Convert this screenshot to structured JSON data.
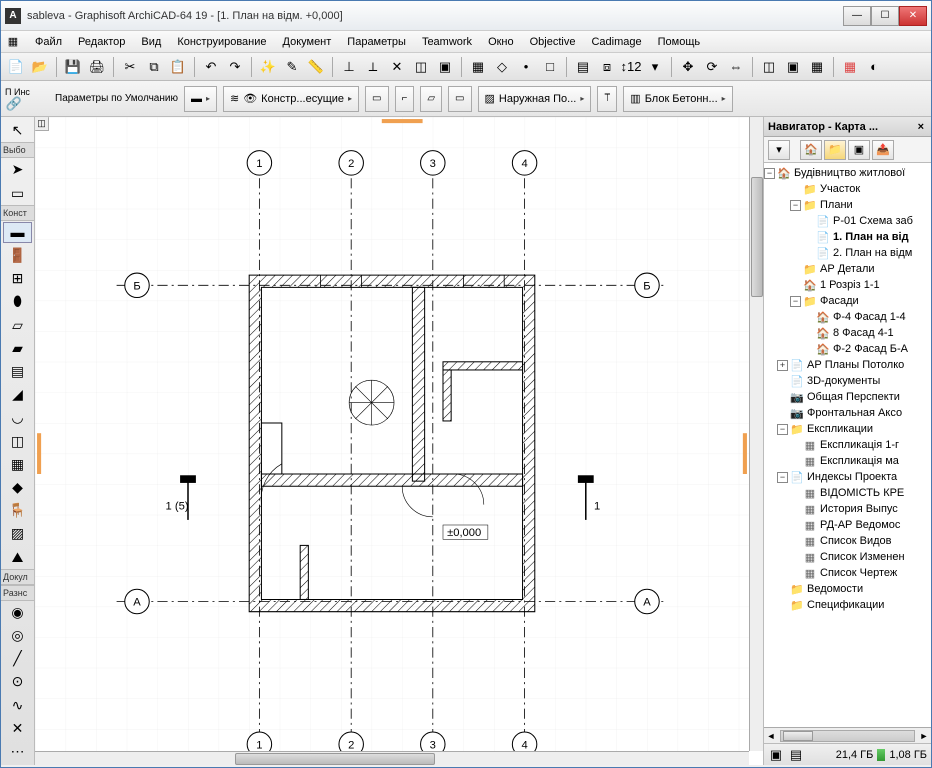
{
  "title": "sableva - Graphisoft ArchiCAD-64 19 - [1. План на відм. +0,000]",
  "menu": [
    "Файл",
    "Редактор",
    "Вид",
    "Конструирование",
    "Документ",
    "Параметры",
    "Teamwork",
    "Окно",
    "Objective",
    "Cadimage",
    "Помощь"
  ],
  "infobox": {
    "panel_label": "Инф",
    "params": "Параметры по Умолчанию",
    "layer": "Констр...есущие",
    "wall_comp": "Наружная По...",
    "material": "Блок Бетонн..."
  },
  "toolbox": {
    "title": "П Инс",
    "section_select": "Выбо",
    "section_construct": "Конст",
    "section_doc": "Докул",
    "section_misc": "Разнс"
  },
  "navigator": {
    "title": "Навигатор - Карта ...",
    "root": "Будівництво житлової",
    "tree": [
      {
        "indent": 1,
        "toggle": "",
        "icon": "folder",
        "label": "Участок"
      },
      {
        "indent": 1,
        "toggle": "-",
        "icon": "folder",
        "label": "Плани"
      },
      {
        "indent": 2,
        "toggle": "",
        "icon": "doc",
        "label": "Р-01 Схема заб"
      },
      {
        "indent": 2,
        "toggle": "",
        "icon": "doc",
        "label": "1. План на від",
        "selected": true
      },
      {
        "indent": 2,
        "toggle": "",
        "icon": "doc",
        "label": "2. План на відм"
      },
      {
        "indent": 1,
        "toggle": "",
        "icon": "folder",
        "label": "АР Детали"
      },
      {
        "indent": 1,
        "toggle": "",
        "icon": "house",
        "label": "1 Розріз 1-1"
      },
      {
        "indent": 1,
        "toggle": "-",
        "icon": "folder",
        "label": "Фасади"
      },
      {
        "indent": 2,
        "toggle": "",
        "icon": "house",
        "label": "Ф-4 Фасад 1-4"
      },
      {
        "indent": 2,
        "toggle": "",
        "icon": "house",
        "label": "8 Фасад 4-1"
      },
      {
        "indent": 2,
        "toggle": "",
        "icon": "house",
        "label": "Ф-2 Фасад Б-А"
      },
      {
        "indent": 0,
        "toggle": "+",
        "icon": "doc",
        "label": "АР Планы Потолко"
      },
      {
        "indent": 0,
        "toggle": "",
        "icon": "doc",
        "label": "3D-документы"
      },
      {
        "indent": 0,
        "toggle": "",
        "icon": "cam",
        "label": "Общая Перспекти"
      },
      {
        "indent": 0,
        "toggle": "",
        "icon": "cam",
        "label": "Фронтальная Аксо"
      },
      {
        "indent": 0,
        "toggle": "-",
        "icon": "folder",
        "label": "Експликации"
      },
      {
        "indent": 1,
        "toggle": "",
        "icon": "grid",
        "label": "Експликація 1-г"
      },
      {
        "indent": 1,
        "toggle": "",
        "icon": "grid",
        "label": "Експликація ма"
      },
      {
        "indent": 0,
        "toggle": "-",
        "icon": "doc",
        "label": "Индексы Проекта"
      },
      {
        "indent": 1,
        "toggle": "",
        "icon": "grid",
        "label": "ВІДОМІСТЬ КРЕ"
      },
      {
        "indent": 1,
        "toggle": "",
        "icon": "grid",
        "label": "История Выпус"
      },
      {
        "indent": 1,
        "toggle": "",
        "icon": "grid",
        "label": "РД-АР Ведомос"
      },
      {
        "indent": 1,
        "toggle": "",
        "icon": "grid",
        "label": "Список Видов"
      },
      {
        "indent": 1,
        "toggle": "",
        "icon": "grid",
        "label": "Список Изменен"
      },
      {
        "indent": 1,
        "toggle": "",
        "icon": "grid",
        "label": "Список Чертеж"
      },
      {
        "indent": 0,
        "toggle": "",
        "icon": "folder",
        "label": "Ведомости"
      },
      {
        "indent": 0,
        "toggle": "",
        "icon": "folder",
        "label": "Спецификации"
      }
    ]
  },
  "canvas": {
    "grids_top": [
      "1",
      "2",
      "3",
      "4"
    ],
    "grids_left": [
      "Б",
      "А"
    ],
    "grids_right": [
      "Б",
      "А"
    ],
    "section_left": "1 (5)",
    "section_right": "1",
    "level_mark": "±0,000"
  },
  "statusbar": {
    "mem1": "21,4 ГБ",
    "mem2": "1,08 ГБ"
  }
}
